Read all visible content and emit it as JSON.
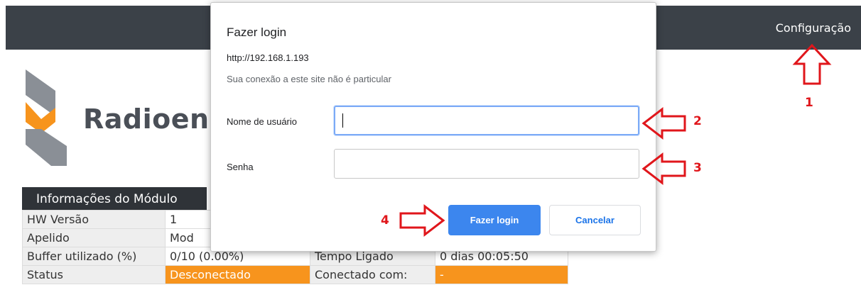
{
  "header": {
    "config_link": "Configuração"
  },
  "brand": {
    "name": "Radioeng"
  },
  "module_info": {
    "title": "Informações do Módulo",
    "rows": [
      {
        "k1": "HW Versão",
        "v1": "1",
        "k2": "",
        "v2": ""
      },
      {
        "k1": "Apelido",
        "v1": "Mod",
        "k2": "",
        "v2": ""
      },
      {
        "k1": "Buffer utilizado (%)",
        "v1": "0/10 (0.00%)",
        "k2": "Tempo Ligado",
        "v2": "0 dias 00:05:50"
      },
      {
        "k1": "Status",
        "v1": "Desconectado",
        "k2": "Conectado com:",
        "v2": "-"
      }
    ]
  },
  "dialog": {
    "title": "Fazer login",
    "url": "http://192.168.1.193",
    "note": "Sua conexão a este site não é particular",
    "username_label": "Nome de usuário",
    "username_value": "",
    "password_label": "Senha",
    "password_value": "",
    "login_button": "Fazer login",
    "cancel_button": "Cancelar"
  },
  "annotations": {
    "n1": "1",
    "n2": "2",
    "n3": "3",
    "n4": "4"
  },
  "colors": {
    "topbar": "#3b4148",
    "accent_orange": "#f7941d",
    "primary_blue": "#3c86ee",
    "annotation_red": "#e0161b"
  }
}
